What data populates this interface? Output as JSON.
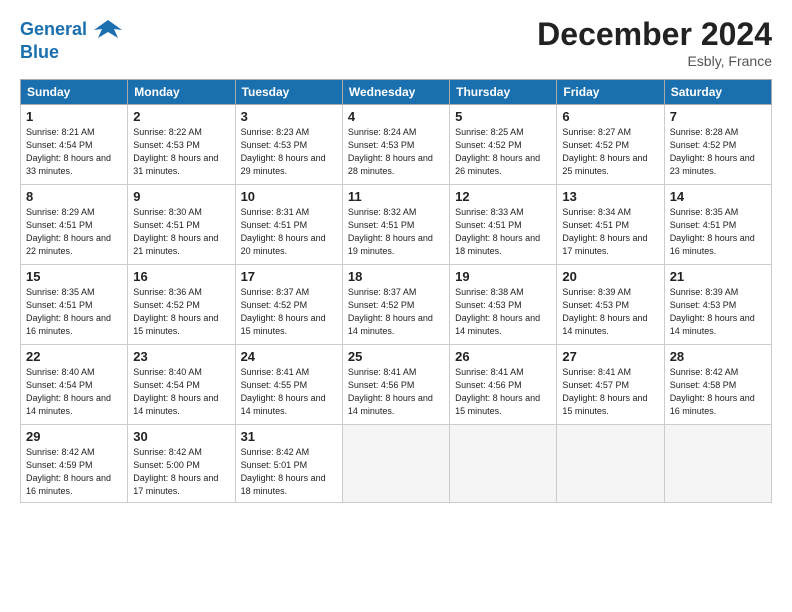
{
  "header": {
    "logo_line1": "General",
    "logo_line2": "Blue",
    "month": "December 2024",
    "location": "Esbly, France"
  },
  "days_of_week": [
    "Sunday",
    "Monday",
    "Tuesday",
    "Wednesday",
    "Thursday",
    "Friday",
    "Saturday"
  ],
  "weeks": [
    [
      {
        "num": "1",
        "sr": "8:21 AM",
        "ss": "4:54 PM",
        "dl": "8 hours and 33 minutes."
      },
      {
        "num": "2",
        "sr": "8:22 AM",
        "ss": "4:53 PM",
        "dl": "8 hours and 31 minutes."
      },
      {
        "num": "3",
        "sr": "8:23 AM",
        "ss": "4:53 PM",
        "dl": "8 hours and 29 minutes."
      },
      {
        "num": "4",
        "sr": "8:24 AM",
        "ss": "4:53 PM",
        "dl": "8 hours and 28 minutes."
      },
      {
        "num": "5",
        "sr": "8:25 AM",
        "ss": "4:52 PM",
        "dl": "8 hours and 26 minutes."
      },
      {
        "num": "6",
        "sr": "8:27 AM",
        "ss": "4:52 PM",
        "dl": "8 hours and 25 minutes."
      },
      {
        "num": "7",
        "sr": "8:28 AM",
        "ss": "4:52 PM",
        "dl": "8 hours and 23 minutes."
      }
    ],
    [
      {
        "num": "8",
        "sr": "8:29 AM",
        "ss": "4:51 PM",
        "dl": "8 hours and 22 minutes."
      },
      {
        "num": "9",
        "sr": "8:30 AM",
        "ss": "4:51 PM",
        "dl": "8 hours and 21 minutes."
      },
      {
        "num": "10",
        "sr": "8:31 AM",
        "ss": "4:51 PM",
        "dl": "8 hours and 20 minutes."
      },
      {
        "num": "11",
        "sr": "8:32 AM",
        "ss": "4:51 PM",
        "dl": "8 hours and 19 minutes."
      },
      {
        "num": "12",
        "sr": "8:33 AM",
        "ss": "4:51 PM",
        "dl": "8 hours and 18 minutes."
      },
      {
        "num": "13",
        "sr": "8:34 AM",
        "ss": "4:51 PM",
        "dl": "8 hours and 17 minutes."
      },
      {
        "num": "14",
        "sr": "8:35 AM",
        "ss": "4:51 PM",
        "dl": "8 hours and 16 minutes."
      }
    ],
    [
      {
        "num": "15",
        "sr": "8:35 AM",
        "ss": "4:51 PM",
        "dl": "8 hours and 16 minutes."
      },
      {
        "num": "16",
        "sr": "8:36 AM",
        "ss": "4:52 PM",
        "dl": "8 hours and 15 minutes."
      },
      {
        "num": "17",
        "sr": "8:37 AM",
        "ss": "4:52 PM",
        "dl": "8 hours and 15 minutes."
      },
      {
        "num": "18",
        "sr": "8:37 AM",
        "ss": "4:52 PM",
        "dl": "8 hours and 14 minutes."
      },
      {
        "num": "19",
        "sr": "8:38 AM",
        "ss": "4:53 PM",
        "dl": "8 hours and 14 minutes."
      },
      {
        "num": "20",
        "sr": "8:39 AM",
        "ss": "4:53 PM",
        "dl": "8 hours and 14 minutes."
      },
      {
        "num": "21",
        "sr": "8:39 AM",
        "ss": "4:53 PM",
        "dl": "8 hours and 14 minutes."
      }
    ],
    [
      {
        "num": "22",
        "sr": "8:40 AM",
        "ss": "4:54 PM",
        "dl": "8 hours and 14 minutes."
      },
      {
        "num": "23",
        "sr": "8:40 AM",
        "ss": "4:54 PM",
        "dl": "8 hours and 14 minutes."
      },
      {
        "num": "24",
        "sr": "8:41 AM",
        "ss": "4:55 PM",
        "dl": "8 hours and 14 minutes."
      },
      {
        "num": "25",
        "sr": "8:41 AM",
        "ss": "4:56 PM",
        "dl": "8 hours and 14 minutes."
      },
      {
        "num": "26",
        "sr": "8:41 AM",
        "ss": "4:56 PM",
        "dl": "8 hours and 15 minutes."
      },
      {
        "num": "27",
        "sr": "8:41 AM",
        "ss": "4:57 PM",
        "dl": "8 hours and 15 minutes."
      },
      {
        "num": "28",
        "sr": "8:42 AM",
        "ss": "4:58 PM",
        "dl": "8 hours and 16 minutes."
      }
    ],
    [
      {
        "num": "29",
        "sr": "8:42 AM",
        "ss": "4:59 PM",
        "dl": "8 hours and 16 minutes."
      },
      {
        "num": "30",
        "sr": "8:42 AM",
        "ss": "5:00 PM",
        "dl": "8 hours and 17 minutes."
      },
      {
        "num": "31",
        "sr": "8:42 AM",
        "ss": "5:01 PM",
        "dl": "8 hours and 18 minutes."
      },
      null,
      null,
      null,
      null
    ]
  ],
  "labels": {
    "sunrise": "Sunrise:",
    "sunset": "Sunset:",
    "daylight": "Daylight:"
  }
}
